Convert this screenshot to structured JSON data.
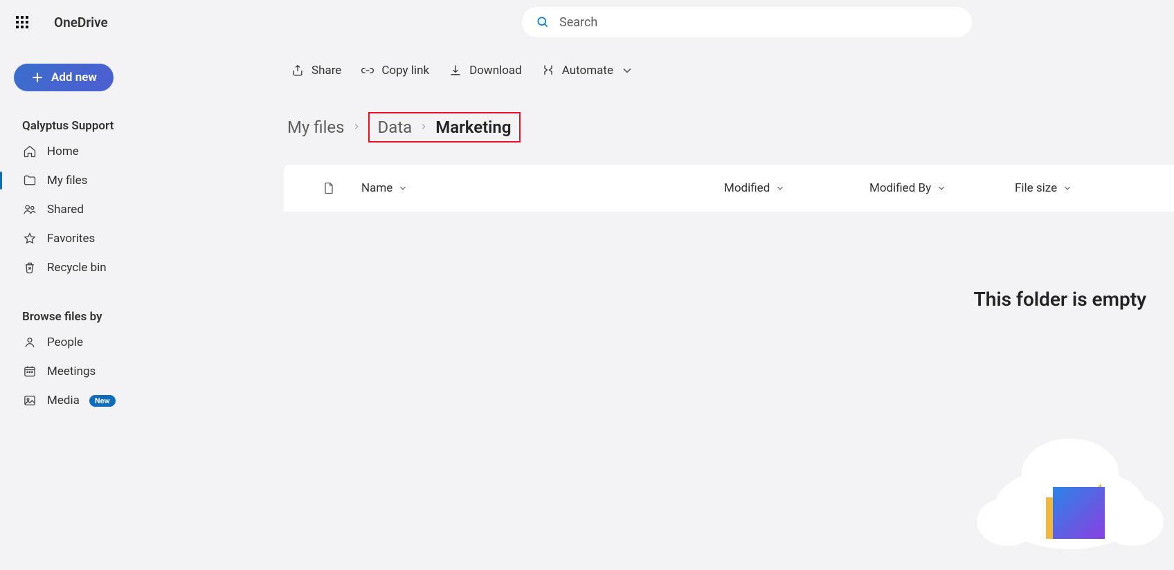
{
  "header": {
    "app_title": "OneDrive",
    "search_placeholder": "Search"
  },
  "sidebar": {
    "add_new_label": "Add new",
    "account_heading": "Qalyptus Support",
    "nav": [
      {
        "label": "Home"
      },
      {
        "label": "My files"
      },
      {
        "label": "Shared"
      },
      {
        "label": "Favorites"
      },
      {
        "label": "Recycle bin"
      }
    ],
    "browse_heading": "Browse files by",
    "browse": [
      {
        "label": "People"
      },
      {
        "label": "Meetings"
      },
      {
        "label": "Media",
        "badge": "New"
      }
    ]
  },
  "toolbar": {
    "share": "Share",
    "copy_link": "Copy link",
    "download": "Download",
    "automate": "Automate"
  },
  "breadcrumb": {
    "root": "My files",
    "folder1": "Data",
    "current": "Marketing"
  },
  "table": {
    "columns": {
      "name": "Name",
      "modified": "Modified",
      "modified_by": "Modified By",
      "file_size": "File size"
    }
  },
  "empty_message": "This folder is empty"
}
